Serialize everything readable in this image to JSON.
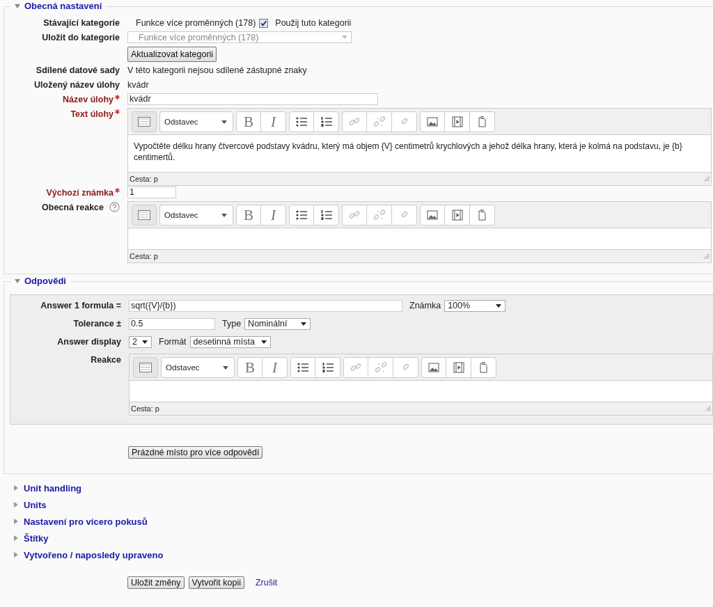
{
  "general": {
    "title": "Obecná nastavení",
    "expanded": true,
    "fields": [
      {
        "kind": "category",
        "label": "Stávající kategorie",
        "required": false,
        "value": "Funkce více proměnných (178)",
        "checked": true,
        "checkbox_label": "Použij tuto kategorii"
      },
      {
        "kind": "select",
        "label": "Uložit do kategorie",
        "required": false,
        "value": "Funkce více proměnných (178)",
        "disabled": true
      },
      {
        "kind": "button",
        "button": "Aktualizovat kategorii"
      },
      {
        "kind": "text",
        "label": "Sdílené datové sady",
        "required": false,
        "value": "V této kategorii nejsou sdílené zástupné znaky"
      },
      {
        "kind": "text",
        "label": "Uložený název úlohy",
        "required": false,
        "value": "kvádr"
      },
      {
        "kind": "name_input",
        "label": "Název úlohy",
        "required": true,
        "value": "kvádr"
      },
      {
        "kind": "editor",
        "label": "Text úlohy",
        "required": true,
        "content": "Vypočtěte délku hrany čtvercové podstavy kvádru, který má objem {V} centimetrů krychlových a jehož délka hrany, která je kolmá na podstavu, je {b} centimertů.",
        "path": "Cesta: p",
        "toolbar": {
          "format": "Odstavec",
          "bold": "B",
          "italic": "I",
          "buttons": [
            {
              "kind": "toggle",
              "disabled": false
            },
            {
              "kind": "bullets",
              "disabled": false
            },
            {
              "kind": "numbers",
              "disabled": false
            },
            {
              "kind": "link",
              "disabled": true
            },
            {
              "kind": "unlink",
              "disabled": true
            },
            {
              "kind": "anchor",
              "disabled": true
            },
            {
              "kind": "image",
              "disabled": false
            },
            {
              "kind": "media",
              "disabled": false
            },
            {
              "kind": "paste",
              "disabled": false
            }
          ]
        }
      },
      {
        "kind": "number_input",
        "label": "Výchozí známka",
        "required": true,
        "value": "1"
      },
      {
        "kind": "editor",
        "label": "Obecná reakce",
        "required": false,
        "help": true,
        "path": "Cesta: p",
        "toolbar": {
          "format": "Odstavec",
          "bold": "B",
          "italic": "I",
          "buttons": [
            {
              "kind": "toggle",
              "disabled": false
            },
            {
              "kind": "bullets",
              "disabled": false
            },
            {
              "kind": "numbers",
              "disabled": false
            },
            {
              "kind": "link",
              "disabled": true
            },
            {
              "kind": "unlink",
              "disabled": true
            },
            {
              "kind": "anchor",
              "disabled": true
            },
            {
              "kind": "image",
              "disabled": false
            },
            {
              "kind": "media",
              "disabled": false
            },
            {
              "kind": "paste",
              "disabled": false
            }
          ]
        }
      }
    ]
  },
  "answers": {
    "title": "Odpovědi",
    "expanded": true,
    "rows": [
      {
        "kind": "formula",
        "label": "Answer 1 formula =",
        "value": "sqrt({V}/{b})",
        "extra_label": "Známka",
        "extra_value": "100%"
      },
      {
        "kind": "tolerance",
        "label": "Tolerance ±",
        "value": "0.5",
        "extra_label": "Type",
        "extra_value": "Nominální"
      },
      {
        "kind": "display",
        "label": "Answer display",
        "value": "2",
        "extra_label": "Formát",
        "extra_value": "desetinná místa"
      },
      {
        "kind": "editor",
        "label": "Reakce",
        "path": "Cesta: p",
        "toolbar": {
          "format": "Odstavec",
          "bold": "B",
          "italic": "I",
          "buttons": [
            {
              "kind": "toggle",
              "disabled": false
            },
            {
              "kind": "bullets",
              "disabled": false
            },
            {
              "kind": "numbers",
              "disabled": false
            },
            {
              "kind": "link",
              "disabled": true
            },
            {
              "kind": "unlink",
              "disabled": true
            },
            {
              "kind": "anchor",
              "disabled": true
            },
            {
              "kind": "image",
              "disabled": false
            },
            {
              "kind": "media",
              "disabled": false
            },
            {
              "kind": "paste",
              "disabled": false
            }
          ]
        }
      }
    ],
    "add_button": "Prázdné místo pro více odpovědí"
  },
  "collapsed_sections": [
    {
      "title": "Unit handling",
      "expanded": false
    },
    {
      "title": "Units",
      "expanded": false
    },
    {
      "title": "Nastavení pro vícero pokusů",
      "expanded": false
    },
    {
      "title": "Štítky",
      "expanded": false
    },
    {
      "title": "Vytvořeno / naposledy upraveno",
      "expanded": false
    }
  ],
  "actions": {
    "buttons": [
      "Uložit změny",
      "Vytvořit kopii"
    ],
    "cancel_link": "Zrušit"
  }
}
